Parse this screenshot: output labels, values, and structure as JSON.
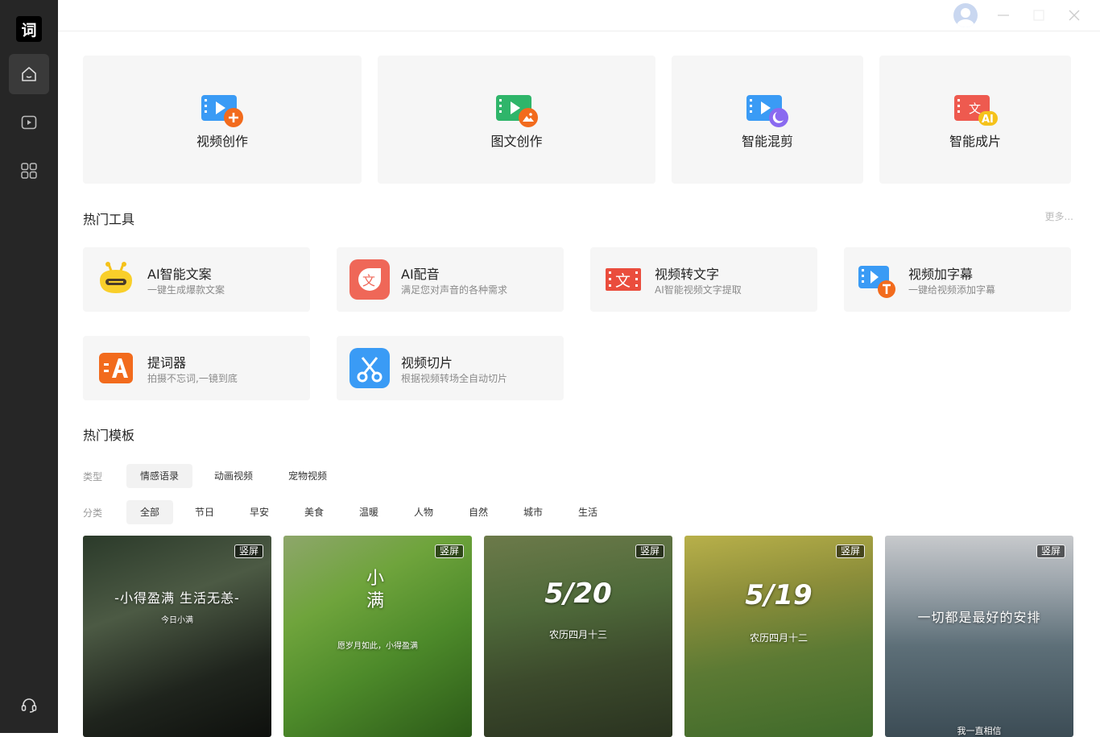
{
  "sidebar": {
    "logo_text": "词",
    "items": [
      {
        "icon": "home-icon"
      },
      {
        "icon": "video-play-icon"
      },
      {
        "icon": "apps-grid-icon"
      }
    ],
    "bottom_icon": "headset-icon"
  },
  "window": {
    "controls": [
      "minimize",
      "maximize",
      "close"
    ]
  },
  "main_cards": [
    {
      "label": "视频创作",
      "icon": "video-create-icon"
    },
    {
      "label": "图文创作",
      "icon": "image-text-create-icon"
    },
    {
      "label": "智能混剪",
      "icon": "smart-mix-icon"
    },
    {
      "label": "智能成片",
      "icon": "ai-film-icon"
    }
  ],
  "hot_tools": {
    "title": "热门工具",
    "more": "更多...",
    "items": [
      {
        "name": "AI智能文案",
        "desc": "一键生成爆款文案",
        "icon": "robot-icon"
      },
      {
        "name": "AI配音",
        "desc": "满足您对声音的各种需求",
        "icon": "voice-text-icon"
      },
      {
        "name": "视频转文字",
        "desc": "AI智能视频文字提取",
        "icon": "video-to-text-icon"
      },
      {
        "name": "视频加字幕",
        "desc": "一键给视频添加字幕",
        "icon": "video-subtitle-icon"
      },
      {
        "name": "提词器",
        "desc": "拍摄不忘词,一镜到底",
        "icon": "teleprompter-icon"
      },
      {
        "name": "视频切片",
        "desc": "根据视频转场全自动切片",
        "icon": "scissors-icon"
      }
    ]
  },
  "hot_templates": {
    "title": "热门模板",
    "type_label": "类型",
    "types": [
      "情感语录",
      "动画视频",
      "宠物视频"
    ],
    "selected_type": "情感语录",
    "category_label": "分类",
    "categories": [
      "全部",
      "节日",
      "早安",
      "美食",
      "温暖",
      "人物",
      "自然",
      "城市",
      "生活"
    ],
    "selected_category": "全部",
    "cards": [
      {
        "badge": "竖屏",
        "text": "-小得盈满 生活无恙-",
        "sub": "今日小满"
      },
      {
        "badge": "竖屏",
        "text": "小满",
        "sub": "愿岁月如此，小得盈满"
      },
      {
        "badge": "竖屏",
        "text": "5/20",
        "sub": "农历四月十三"
      },
      {
        "badge": "竖屏",
        "text": "5/19",
        "sub": "农历四月十二"
      },
      {
        "badge": "竖屏",
        "text": "一切都是最好的安排",
        "sub": "",
        "bottom": "我一直相信"
      }
    ]
  },
  "colors": {
    "sidebar": "#262626",
    "card_bg": "#f6f6f6",
    "accent_orange": "#f26b1d",
    "accent_blue": "#3a9bf5"
  }
}
